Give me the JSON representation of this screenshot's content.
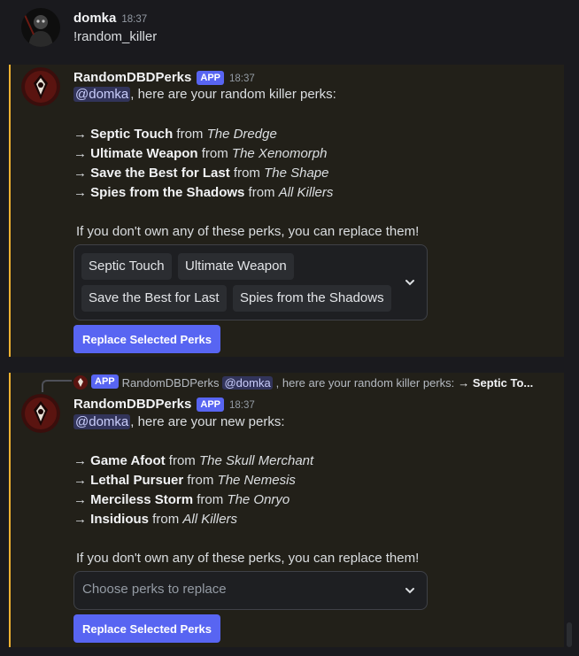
{
  "colors": {
    "accent": "#5865f2",
    "highlight_border": "#f0b232",
    "background": "#1a1a1e"
  },
  "msg1": {
    "author": "domka",
    "time": "18:37",
    "text": "!random_killer"
  },
  "msg2": {
    "author": "RandomDBDPerks",
    "badge": "APP",
    "time": "18:37",
    "mention": "@domka",
    "intro": ", here are your random killer perks:",
    "perks": [
      {
        "arrow": "→",
        "name": "Septic Touch",
        "from": " from ",
        "owner": "The Dredge"
      },
      {
        "arrow": "→",
        "name": "Ultimate Weapon",
        "from": " from ",
        "owner": "The Xenomorph"
      },
      {
        "arrow": "→",
        "name": "Save the Best for Last",
        "from": " from ",
        "owner": "The Shape"
      },
      {
        "arrow": "→",
        "name": "Spies from the Shadows",
        "from": " from ",
        "owner": "All Killers"
      }
    ],
    "replace_note": "If you don't own any of these perks, you can replace them!",
    "selected": [
      "Septic Touch",
      "Ultimate Weapon",
      "Save the Best for Last",
      "Spies from the Shadows"
    ],
    "button": "Replace Selected Perks"
  },
  "reply_preview": {
    "badge": "APP",
    "author": "RandomDBDPerks",
    "mention": "@domka",
    "text": ", here are your random killer perks:",
    "perk": "→ Septic To..."
  },
  "msg3": {
    "author": "RandomDBDPerks",
    "badge": "APP",
    "time": "18:37",
    "mention": "@domka",
    "intro": ", here are your new perks:",
    "perks": [
      {
        "arrow": "→",
        "name": "Game Afoot",
        "from": " from ",
        "owner": "The Skull Merchant"
      },
      {
        "arrow": "→",
        "name": "Lethal Pursuer",
        "from": " from ",
        "owner": "The Nemesis"
      },
      {
        "arrow": "→",
        "name": "Merciless Storm",
        "from": " from ",
        "owner": "The Onryo"
      },
      {
        "arrow": "→",
        "name": "Insidious",
        "from": " from ",
        "owner": "All Killers"
      }
    ],
    "replace_note": "If you don't own any of these perks, you can replace them!",
    "placeholder": "Choose perks to replace",
    "button": "Replace Selected Perks"
  }
}
